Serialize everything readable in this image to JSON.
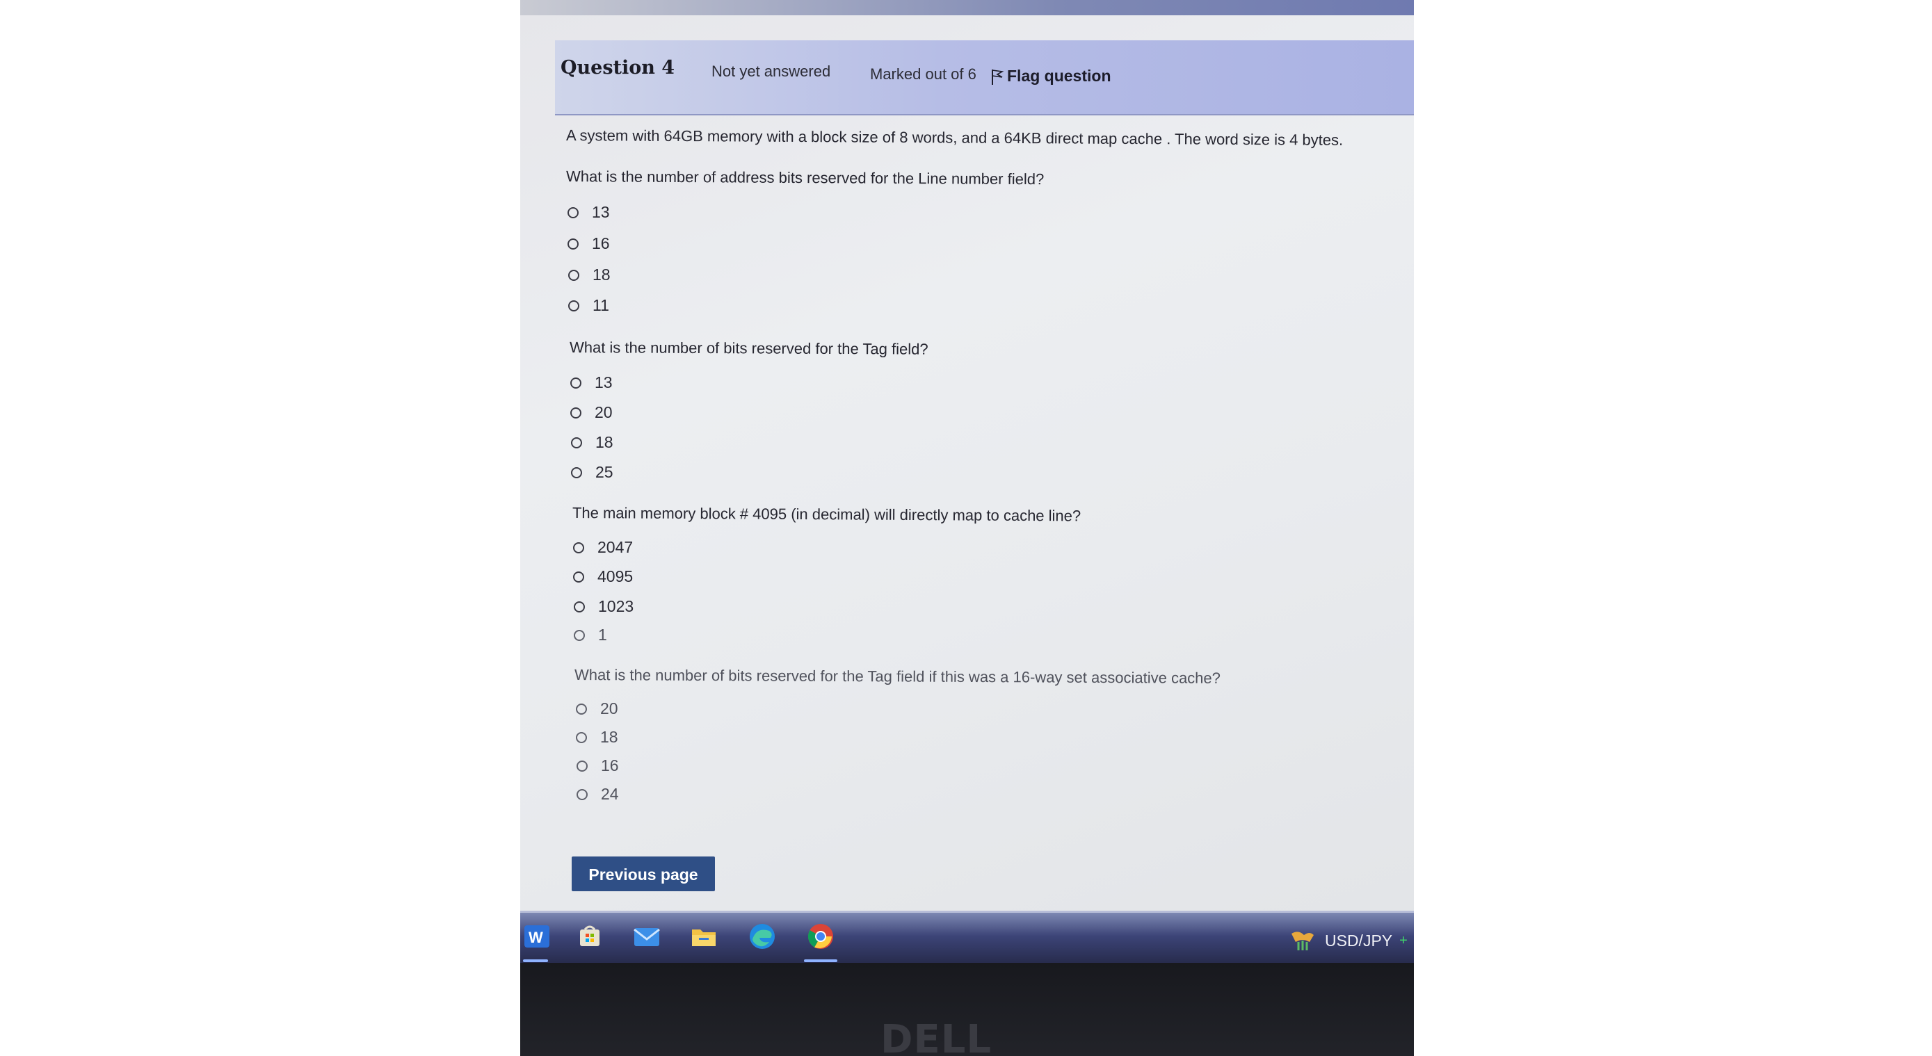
{
  "quiz": {
    "header": {
      "question_title": "Question 4",
      "status": "Not yet answered",
      "marks": "Marked out of 6",
      "flag_label": "Flag question"
    },
    "intro": "A system with 64GB memory with a block size of 8 words, and a 64KB direct map cache . The word size is 4 bytes.",
    "parts": [
      {
        "prompt": "What is the number of address bits reserved for the Line number field?",
        "options": [
          "13",
          "16",
          "18",
          "11"
        ]
      },
      {
        "prompt": "What is the number of bits reserved for the Tag field?",
        "options": [
          "13",
          "20",
          "18",
          "25"
        ]
      },
      {
        "prompt": "The main memory block # 4095 (in decimal) will directly map to cache line?",
        "options": [
          "2047",
          "4095",
          "1023",
          "1"
        ]
      },
      {
        "prompt": "What is the number of bits reserved for the Tag field if this was a 16-way set associative cache?",
        "options": [
          "20",
          "18",
          "16",
          "24"
        ]
      }
    ],
    "previous_button": "Previous page"
  },
  "taskbar": {
    "apps": [
      "word-icon",
      "store-icon",
      "mail-icon",
      "file-explorer-icon",
      "edge-icon",
      "chrome-icon"
    ],
    "ticker_label": "USD/JPY",
    "ticker_change": "+"
  },
  "device": {
    "brand": "DELL"
  },
  "colors": {
    "header_bg": "#b6bde6",
    "button_bg": "#2f4f86",
    "taskbar_bg": "#3c4477"
  }
}
